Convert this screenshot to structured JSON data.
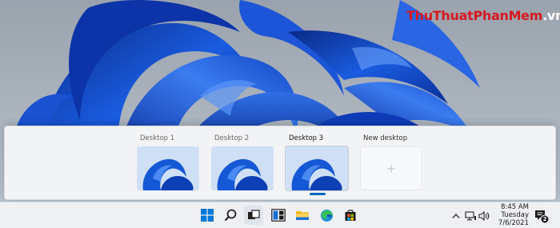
{
  "watermark": {
    "part1": "Thu",
    "part2": "Thuat",
    "part3": "Phan",
    "part4": "Mem",
    "part5": ".vn"
  },
  "desktops": [
    {
      "label": "Desktop 1",
      "active": false
    },
    {
      "label": "Desktop 2",
      "active": false
    },
    {
      "label": "Desktop 3",
      "active": true
    }
  ],
  "new_desktop": {
    "label": "New desktop",
    "icon": "plus-icon"
  },
  "taskbar": {
    "apps": [
      {
        "name": "start-icon"
      },
      {
        "name": "search-icon"
      },
      {
        "name": "task-view-icon"
      },
      {
        "name": "widgets-icon"
      },
      {
        "name": "file-explorer-icon"
      },
      {
        "name": "edge-icon"
      },
      {
        "name": "store-icon"
      }
    ],
    "tray": {
      "chevron": "^",
      "notification_count": "2"
    },
    "clock": {
      "time": "8:45 AM",
      "day": "Tuesday",
      "date": "7/6/2021"
    }
  },
  "colors": {
    "accent": "#0067c0",
    "watermark_red": "#d71920",
    "wallpaper_blue": "#1558d6"
  }
}
